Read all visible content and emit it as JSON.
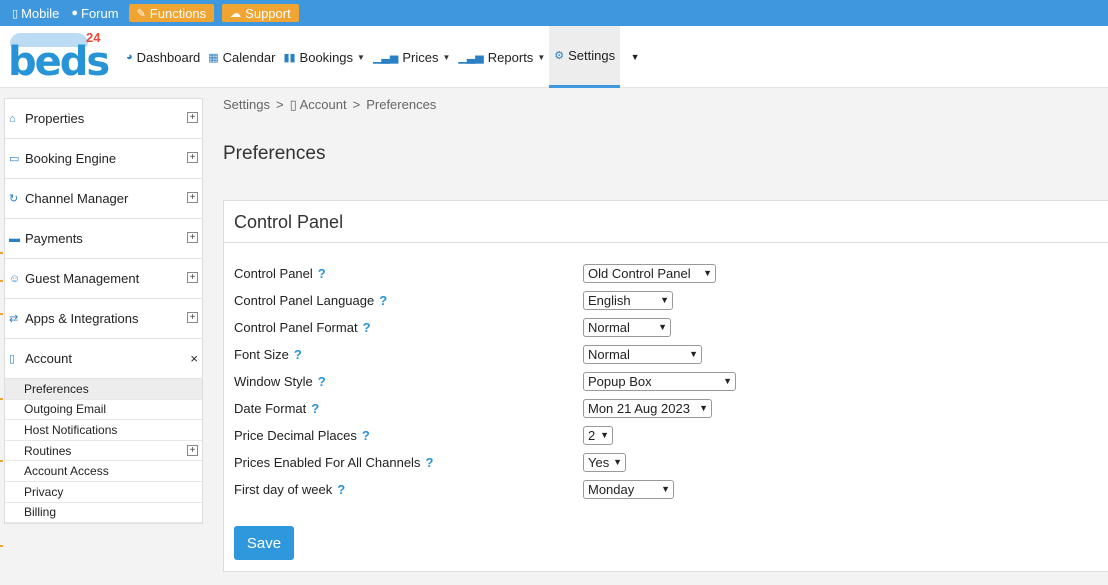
{
  "topbar": {
    "mobile": "Mobile",
    "forum": "Forum",
    "functions": "Functions",
    "support": "Support"
  },
  "logo": {
    "text": "beds",
    "superscript": "24"
  },
  "nav": {
    "dashboard": "Dashboard",
    "calendar": "Calendar",
    "bookings": "Bookings",
    "prices": "Prices",
    "reports": "Reports",
    "settings": "Settings"
  },
  "sidebar": {
    "items": [
      {
        "label": "Properties"
      },
      {
        "label": "Booking Engine"
      },
      {
        "label": "Channel Manager"
      },
      {
        "label": "Payments"
      },
      {
        "label": "Guest Management"
      },
      {
        "label": "Apps & Integrations"
      },
      {
        "label": "Account"
      }
    ],
    "account_sub": [
      {
        "label": "Preferences"
      },
      {
        "label": "Outgoing Email"
      },
      {
        "label": "Host Notifications"
      },
      {
        "label": "Routines"
      },
      {
        "label": "Account Access"
      },
      {
        "label": "Privacy"
      },
      {
        "label": "Billing"
      }
    ]
  },
  "breadcrumb": {
    "root": "Settings",
    "sep": ">",
    "account": "Account",
    "current": "Preferences"
  },
  "page": {
    "title": "Preferences"
  },
  "panel": {
    "title": "Control Panel",
    "help": "?",
    "fields": [
      {
        "label": "Control Panel",
        "value": "Old Control Panel"
      },
      {
        "label": "Control Panel Language",
        "value": "English"
      },
      {
        "label": "Control Panel Format",
        "value": "Normal"
      },
      {
        "label": "Font Size",
        "value": "Normal"
      },
      {
        "label": "Window Style",
        "value": "Popup Box"
      },
      {
        "label": "Date Format",
        "value": "Mon 21 Aug 2023"
      },
      {
        "label": "Price Decimal Places",
        "value": "2"
      },
      {
        "label": "Prices Enabled For All Channels",
        "value": "Yes"
      },
      {
        "label": "First day of week",
        "value": "Monday"
      }
    ],
    "save": "Save"
  },
  "colors": {
    "topbar": "#3f97dd",
    "orange": "#f0a431",
    "accent": "#2f98dc"
  },
  "icons": [
    "mobile-icon",
    "forum-icon",
    "wrench-icon",
    "support-icon",
    "dashboard-icon",
    "calendar-icon",
    "bookings-icon",
    "prices-icon",
    "reports-icon",
    "settings-icon",
    "home-icon",
    "monitor-icon",
    "sync-icon",
    "card-icon",
    "users-icon",
    "arrows-icon",
    "file-icon"
  ]
}
